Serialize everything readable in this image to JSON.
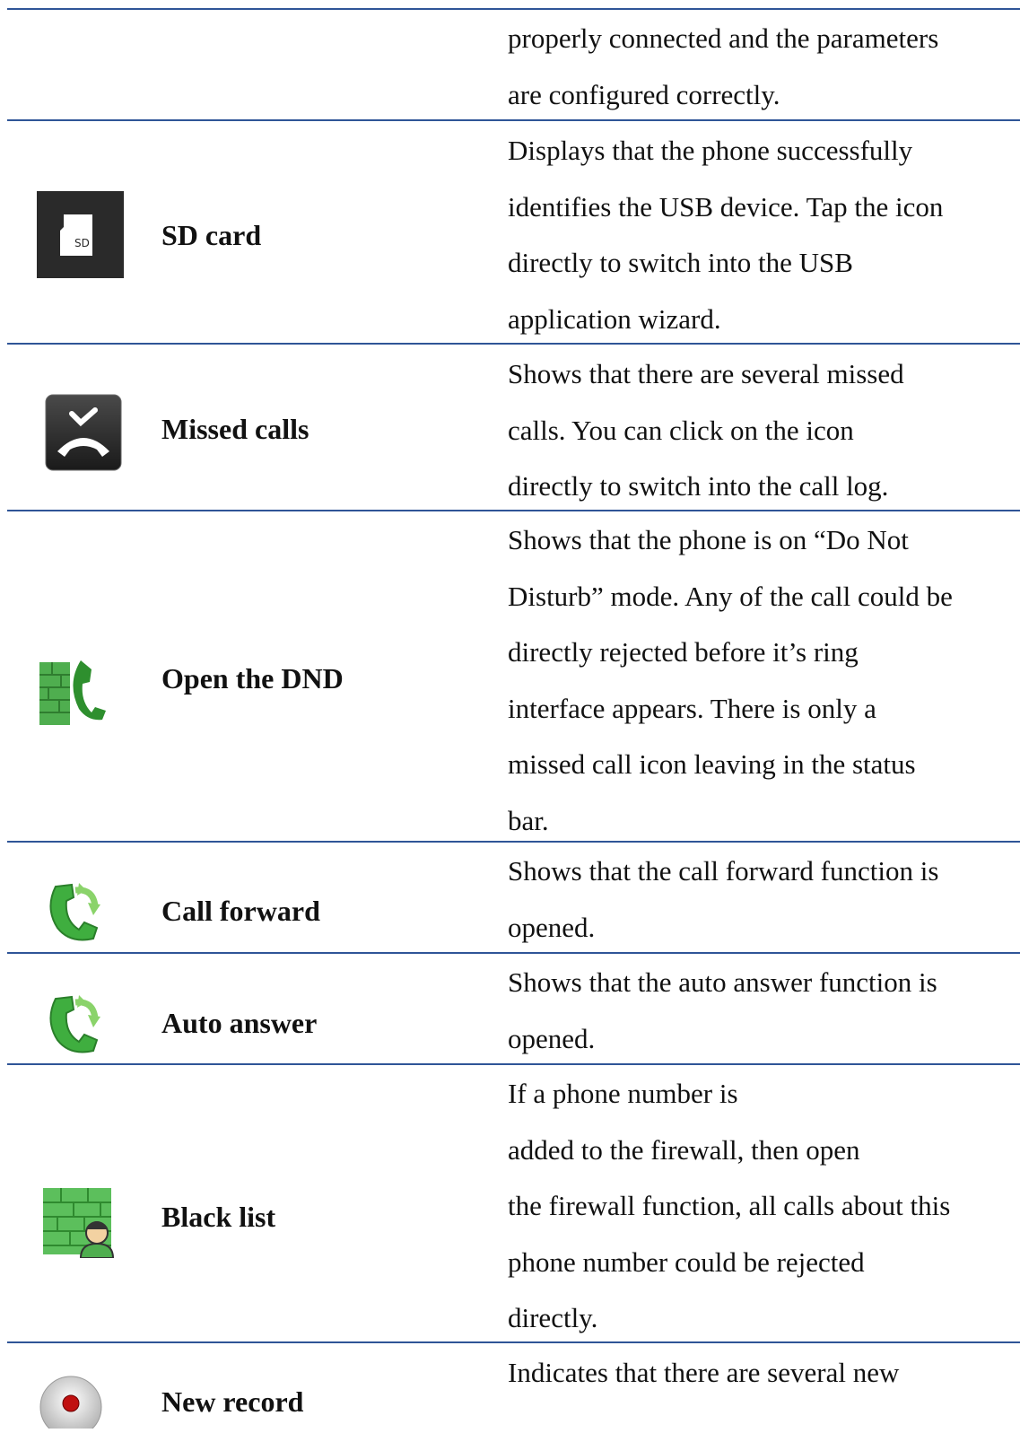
{
  "rows": [
    {
      "name": "",
      "icon": "",
      "description": [
        "properly connected and the parameters",
        "are configured correctly."
      ]
    },
    {
      "name": "SD card",
      "icon": "sd-card-icon",
      "description": [
        "Displays that the phone successfully",
        "identifies the USB device. Tap the icon",
        "directly to switch into the USB",
        "application wizard."
      ]
    },
    {
      "name": "Missed calls",
      "icon": "missed-call-icon",
      "description": [
        "Shows that there are several missed",
        "calls.   You can click on the icon",
        "directly to switch into the call log."
      ]
    },
    {
      "name": "Open the DND",
      "icon": "dnd-icon",
      "description": [
        "Shows that the phone is on “Do Not",
        "Disturb” mode. Any of the call could be",
        "directly rejected before it’s ring",
        "interface appears. There is only a",
        "missed call icon leaving in the status",
        "bar."
      ]
    },
    {
      "name": "Call forward",
      "icon": "call-forward-icon",
      "description": [
        "Shows that the call forward function is",
        "opened."
      ]
    },
    {
      "name": "Auto answer",
      "icon": "auto-answer-icon",
      "description": [
        "Shows that the auto answer function is",
        "opened."
      ]
    },
    {
      "name": "Black list",
      "icon": "black-list-icon",
      "description": [
        "If a phone number is",
        "added to the firewall, then open",
        "the firewall function, all calls about this",
        "phone number could be rejected",
        "directly."
      ]
    },
    {
      "name": "New record",
      "icon": "record-icon",
      "description": [
        "Indicates that there are several new"
      ]
    }
  ],
  "colors": {
    "rule": "#2f5597",
    "text": "#111111",
    "icon_dark": "#2a2a2a",
    "icon_green": "#5cc85a",
    "record_red": "#c01010"
  }
}
